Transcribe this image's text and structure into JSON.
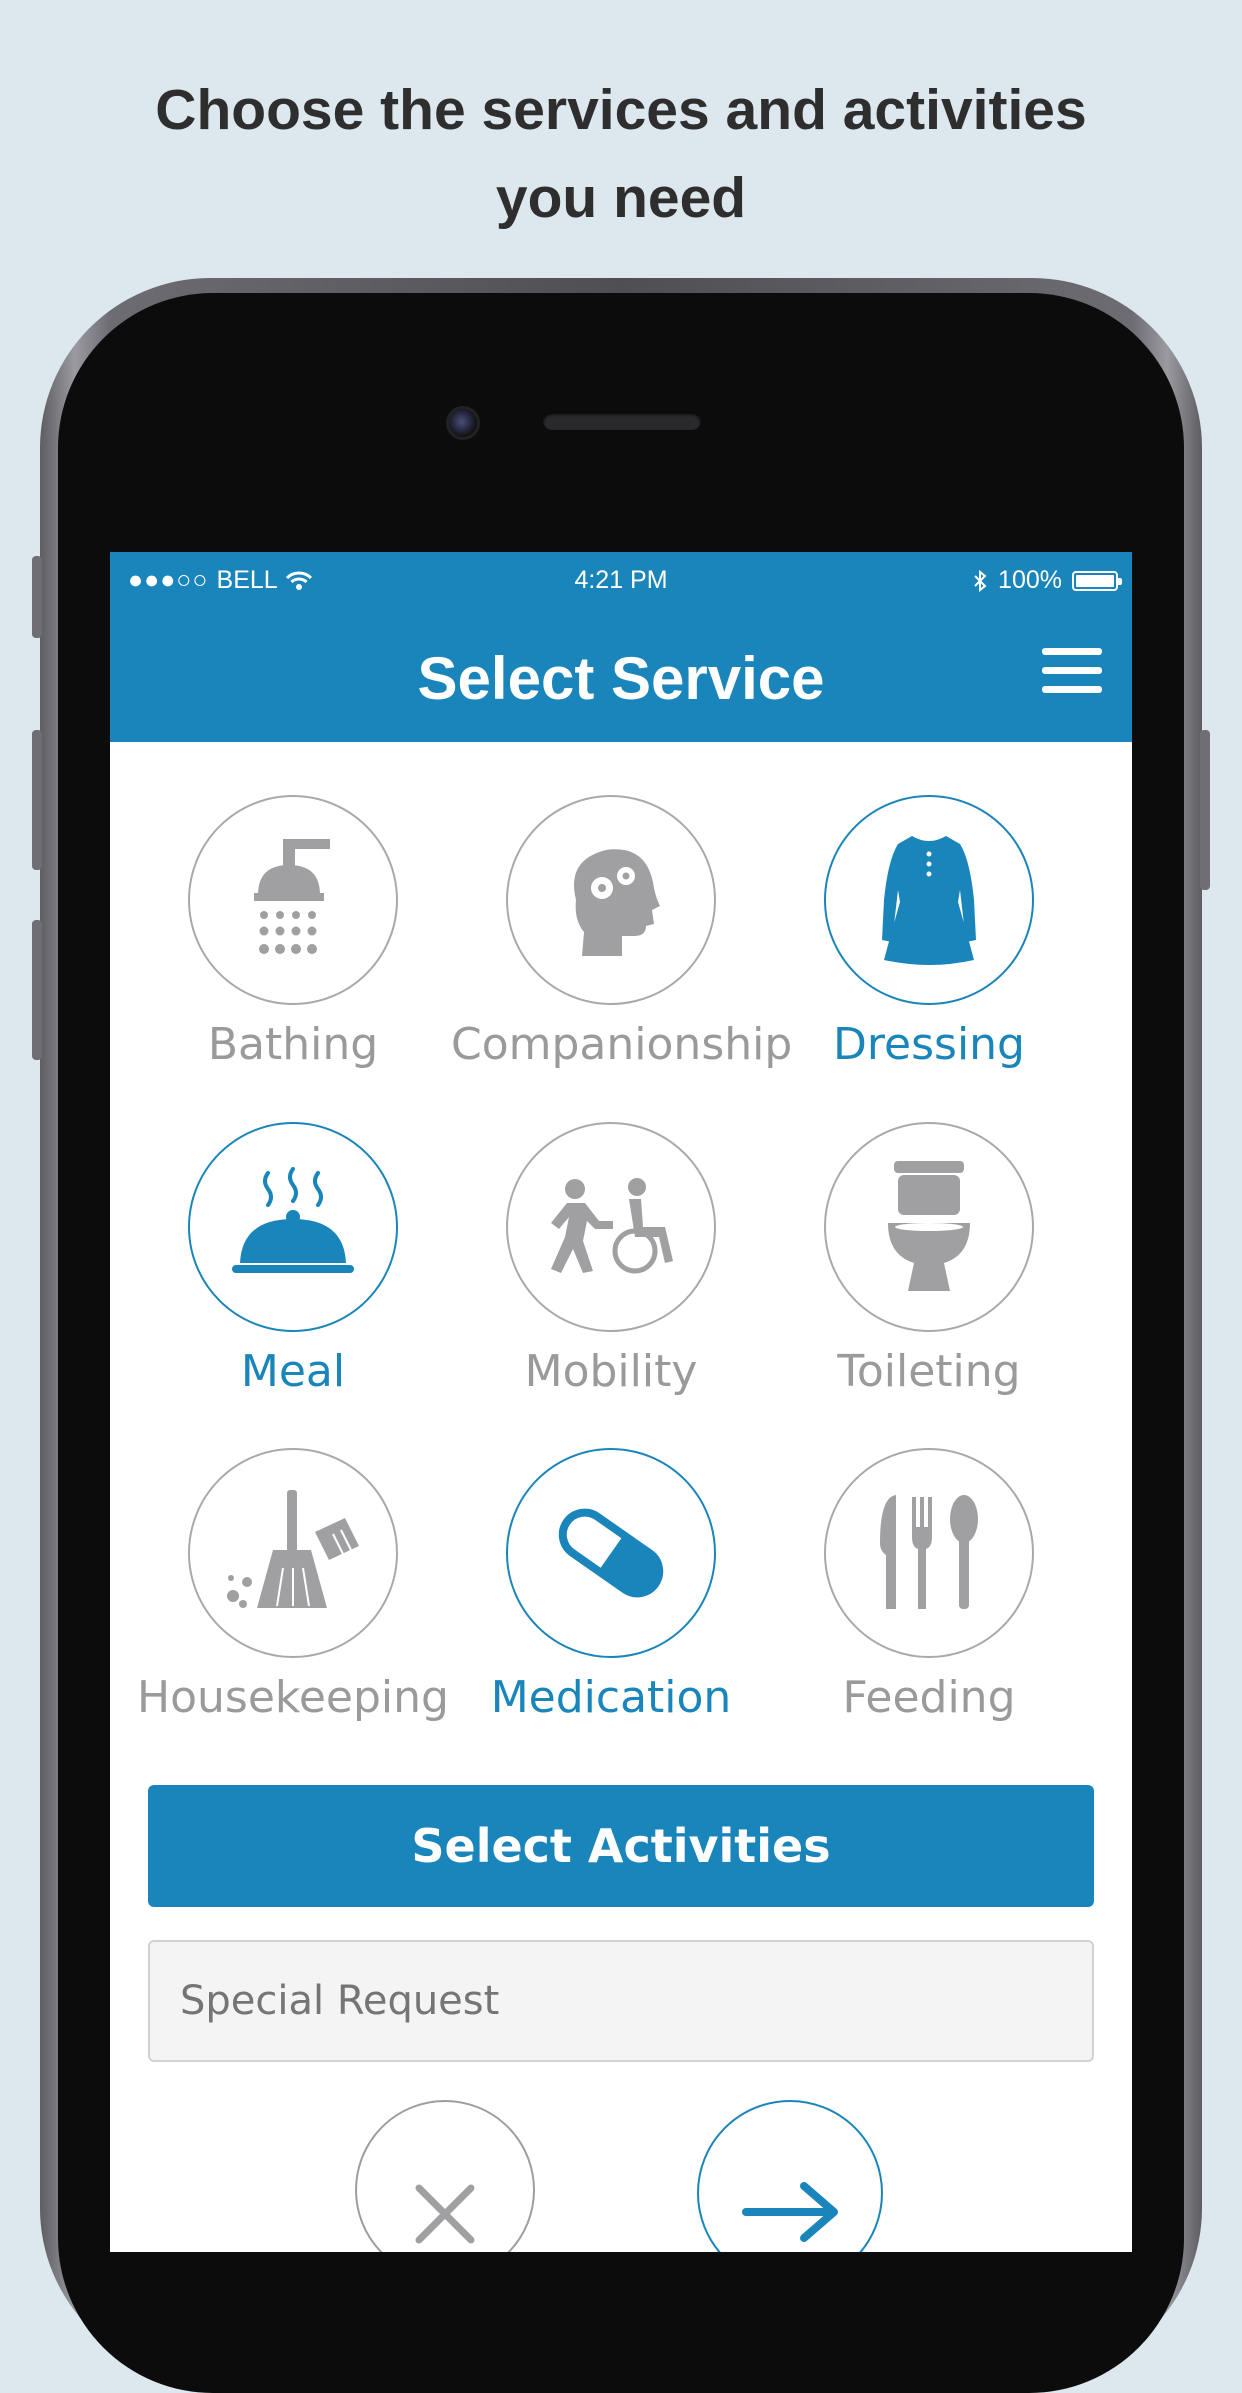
{
  "headline": {
    "line1": "Choose the services and activities",
    "line2": "you need"
  },
  "colors": {
    "accent": "#1a85bb",
    "inactive": "#9a9a9a",
    "background": "#dde7ee"
  },
  "status_bar": {
    "signal": "●●●○○",
    "carrier": "BELL",
    "time": "4:21 PM",
    "battery": "100%",
    "icons": [
      "wifi-icon",
      "bluetooth-icon",
      "battery-icon"
    ]
  },
  "nav": {
    "title": "Select Service",
    "menu_icon": "hamburger-menu-icon"
  },
  "services": [
    {
      "label": "Bathing",
      "icon": "shower-icon",
      "selected": false
    },
    {
      "label": "Companionship",
      "icon": "head-gears-icon",
      "selected": false
    },
    {
      "label": "Dressing",
      "icon": "dress-icon",
      "selected": true
    },
    {
      "label": "Meal",
      "icon": "food-cloche-icon",
      "selected": true
    },
    {
      "label": "Mobility",
      "icon": "wheelchair-assist-icon",
      "selected": false
    },
    {
      "label": "Toileting",
      "icon": "toilet-icon",
      "selected": false
    },
    {
      "label": "Housekeeping",
      "icon": "broom-icon",
      "selected": false
    },
    {
      "label": "Medication",
      "icon": "pill-icon",
      "selected": true
    },
    {
      "label": "Feeding",
      "icon": "cutlery-icon",
      "selected": false
    }
  ],
  "activities_button": {
    "label": "Select Activities"
  },
  "special_request": {
    "placeholder": "Special Request",
    "value": ""
  },
  "bottom_actions": {
    "cancel_icon": "close-icon",
    "next_icon": "arrow-right-icon"
  }
}
